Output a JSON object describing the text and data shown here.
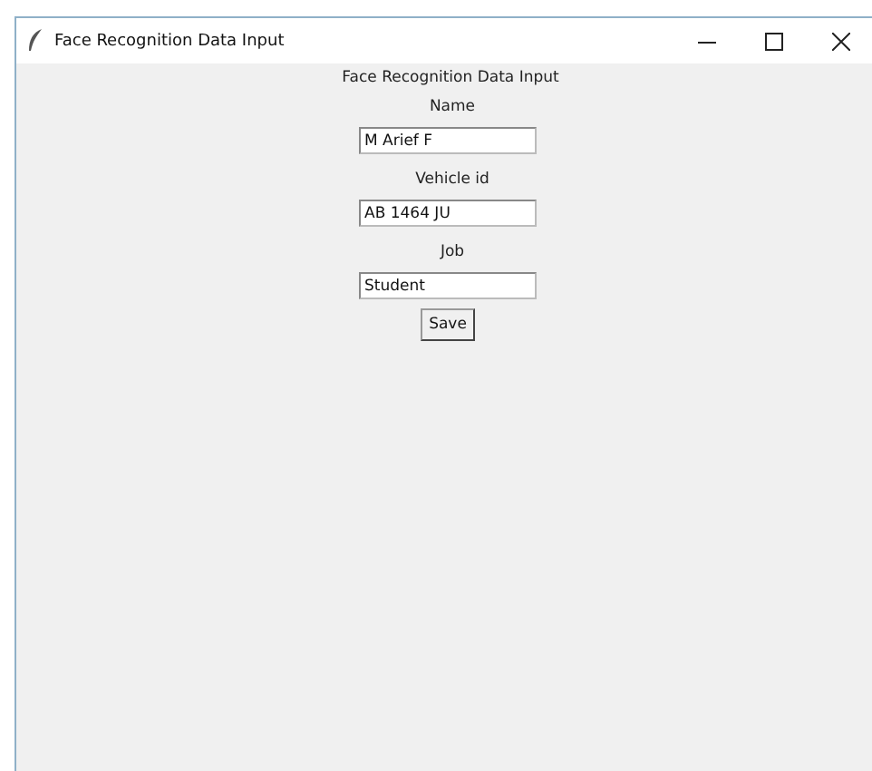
{
  "window": {
    "title": "Face Recognition Data Input"
  },
  "heading": "Face Recognition Data Input",
  "fields": [
    {
      "label": "Name",
      "value": "M Arief F"
    },
    {
      "label": "Vehicle id",
      "value": "AB 1464 JU"
    },
    {
      "label": "Job",
      "value": "Student"
    }
  ],
  "buttons": [
    "Save"
  ]
}
